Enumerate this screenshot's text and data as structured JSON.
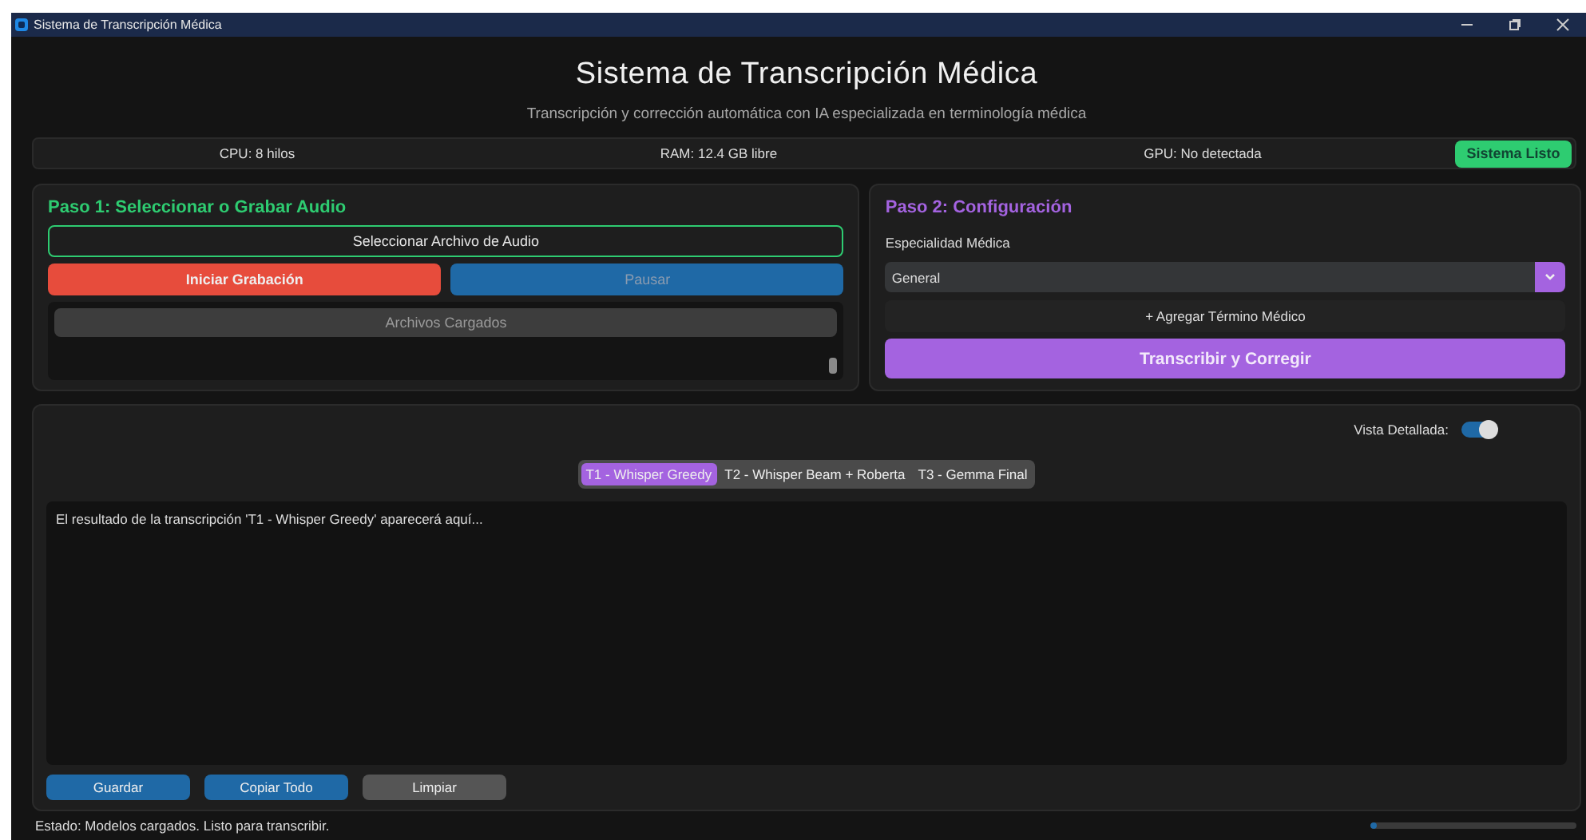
{
  "window": {
    "title": "Sistema de Transcripción Médica"
  },
  "header": {
    "title": "Sistema de Transcripción Médica",
    "subtitle": "Transcripción y corrección automática con IA especializada en terminología médica"
  },
  "system_info": {
    "items": [
      "CPU: 8 hilos",
      "RAM: 12.4 GB libre",
      "GPU: No detectada"
    ],
    "status_button": "Sistema Listo"
  },
  "step1": {
    "title": "Paso 1: Seleccionar o Grabar Audio",
    "select_button": "Seleccionar Archivo de Audio",
    "record_button": "Iniciar Grabación",
    "pause_button": {
      "label": "Pausar",
      "disabled": true
    },
    "files_header": {
      "label": "Archivos Cargados",
      "disabled": true
    }
  },
  "step2": {
    "title": "Paso 2: Configuración",
    "specialty_label": "Especialidad Médica",
    "specialty": {
      "value": "General"
    },
    "add_term_button": "+ Agregar Término Médico",
    "transcribe_button": "Transcribir y Corregir"
  },
  "results": {
    "detailed_view": {
      "label": "Vista Detallada:",
      "on": true
    },
    "tabs": [
      {
        "label": "T1 - Whisper Greedy",
        "selected": true
      },
      {
        "label": "T2 - Whisper Beam + Roberta",
        "selected": false
      },
      {
        "label": "T3 - Gemma Final",
        "selected": false
      }
    ],
    "output": {
      "value": "El resultado de la transcripción 'T1 - Whisper Greedy' aparecerá aquí..."
    },
    "buttons": [
      {
        "label": "Guardar",
        "kind": "primary"
      },
      {
        "label": "Copiar Todo",
        "kind": "primary"
      },
      {
        "label": "Limpiar",
        "kind": "secondary"
      }
    ]
  },
  "status_bar": {
    "text": "Estado: Modelos cargados. Listo para transcribir.",
    "progress": {
      "level": 0.03
    }
  }
}
